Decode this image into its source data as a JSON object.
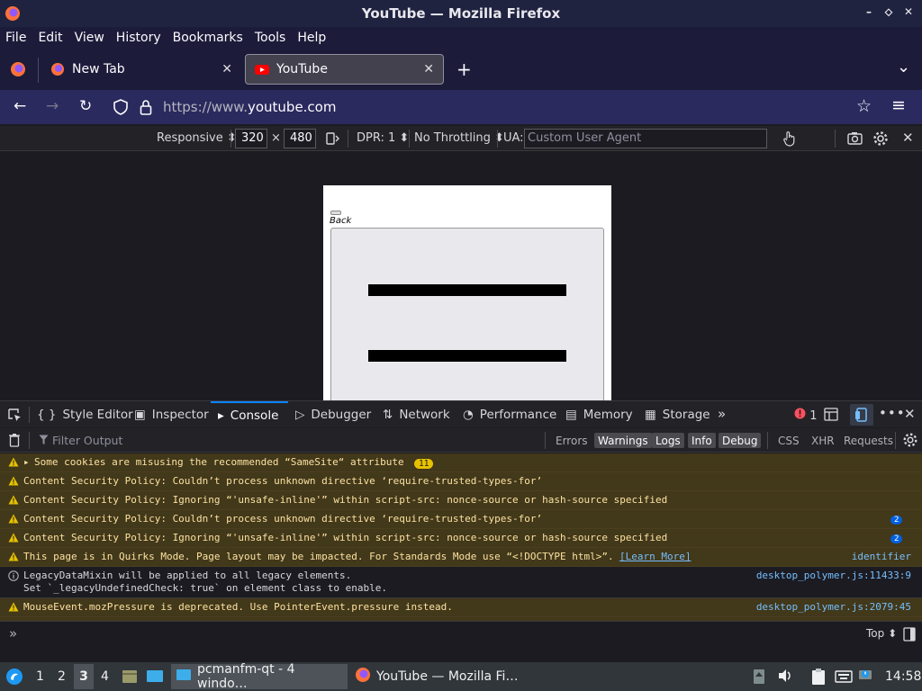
{
  "window": {
    "title": "YouTube — Mozilla Firefox",
    "controls": [
      "–",
      "⬦",
      "✕"
    ]
  },
  "menu": [
    "File",
    "Edit",
    "View",
    "History",
    "Bookmarks",
    "Tools",
    "Help"
  ],
  "tabs": [
    {
      "label": "New Tab",
      "close": "✕"
    },
    {
      "label": "YouTube",
      "close": "✕"
    }
  ],
  "new_tab": "+",
  "list_tabs": "⌄",
  "nav": {
    "url_prefix": "https://www.",
    "url_host": "youtube.com",
    "back": "←",
    "forward": "→",
    "reload": "↻",
    "menu": "≡",
    "bookmark": "☆"
  },
  "rdm": {
    "device": "Responsive",
    "width": "320",
    "height": "480",
    "times": "×",
    "dpr": "DPR: 1",
    "throttling": "No Throttling",
    "ua_label": "UA:",
    "ua_placeholder": "Custom User Agent"
  },
  "device_page": {
    "back_label": "Back"
  },
  "devtools": {
    "tabs": [
      "Style Editor",
      "Inspector",
      "Console",
      "Debugger",
      "Network",
      "Performance",
      "Memory",
      "Storage"
    ],
    "error_count": "1",
    "filter_placeholder": "Filter Output",
    "filters": [
      "Errors",
      "Warnings",
      "Logs",
      "Info",
      "Debug",
      "CSS",
      "XHR",
      "Requests"
    ],
    "context": "Top"
  },
  "console_messages": [
    {
      "type": "warn",
      "text": "Some cookies are misusing the recommended “SameSite“ attribute",
      "badge": "11",
      "source": ""
    },
    {
      "type": "warn",
      "text": "Content Security Policy: Couldn’t process unknown directive ‘require-trusted-types-for’",
      "badge": "",
      "source": ""
    },
    {
      "type": "warn",
      "text": "Content Security Policy: Ignoring “'unsafe-inline'” within script-src: nonce-source or hash-source specified",
      "badge": "",
      "source": ""
    },
    {
      "type": "warn",
      "text": "Content Security Policy: Couldn’t process unknown directive ‘require-trusted-types-for’",
      "badge": "2",
      "source": ""
    },
    {
      "type": "warn",
      "text": "Content Security Policy: Ignoring “'unsafe-inline'” within script-src: nonce-source or hash-source specified",
      "badge": "2",
      "source": ""
    },
    {
      "type": "warn",
      "text": "This page is in Quirks Mode. Page layout may be impacted. For Standards Mode use “<!DOCTYPE html>”.",
      "link": "[Learn More]",
      "source": "identifier"
    },
    {
      "type": "info",
      "text": "LegacyDataMixin will be applied to all legacy elements.",
      "text2": "Set `_legacyUndefinedCheck: true` on element class to enable.",
      "source": "desktop_polymer.js:11433:9"
    },
    {
      "type": "warn",
      "text": "MouseEvent.mozPressure is deprecated. Use PointerEvent.pressure instead.",
      "source": "desktop_polymer.js:2079:45"
    }
  ],
  "taskbar": {
    "workspaces": [
      "1",
      "2",
      "3",
      "4"
    ],
    "windows": [
      "pcmanfm-qt - 4 windo…",
      "YouTube — Mozilla Fi…"
    ],
    "clock": "14:58"
  }
}
